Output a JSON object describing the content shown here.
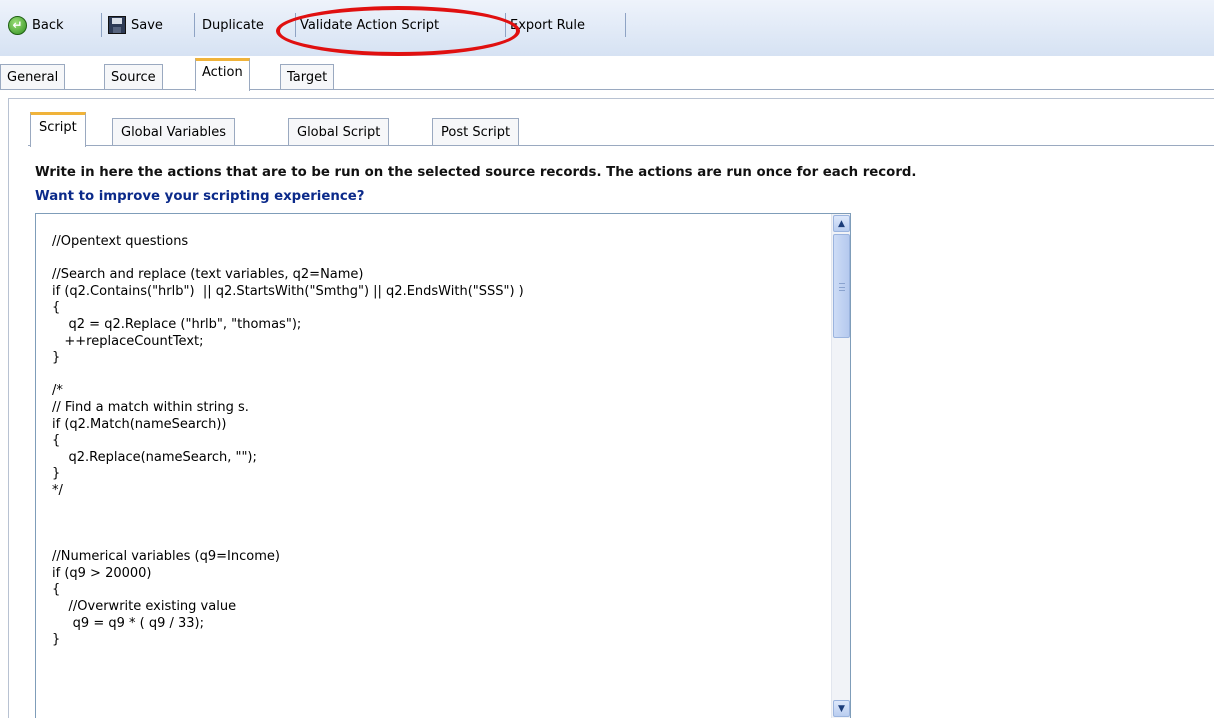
{
  "toolbar": {
    "back_label": "Back",
    "save_label": "Save",
    "duplicate_label": "Duplicate",
    "validate_label": "Validate Action Script",
    "export_label": "Export Rule",
    "back_icon_glyph": "↵"
  },
  "main_tabs": [
    {
      "label": "General",
      "active": false
    },
    {
      "label": "Source",
      "active": false
    },
    {
      "label": "Action",
      "active": true
    },
    {
      "label": "Target",
      "active": false
    }
  ],
  "sub_tabs": [
    {
      "label": "Script",
      "active": true
    },
    {
      "label": "Global Variables",
      "active": false
    },
    {
      "label": "Global Script",
      "active": false
    },
    {
      "label": "Post Script",
      "active": false
    }
  ],
  "description": "Write in here the actions that are to be run on the selected source records. The actions are run once for each record.",
  "improve_link": "Want to improve your scripting experience?",
  "script_lines": [
    "//Opentext questions",
    "",
    "//Search and replace (text variables, q2=Name)",
    "if (q2.Contains(\"hrlb\")  || q2.StartsWith(\"Smthg\") || q2.EndsWith(\"SSS\") )",
    "{",
    "    q2 = q2.Replace (\"hrlb\", \"thomas\");",
    "   ++replaceCountText;",
    "}",
    "",
    "/*",
    "// Find a match within string s.",
    "if (q2.Match(nameSearch))",
    "{",
    "    q2.Replace(nameSearch, \"\");",
    "}",
    "*/",
    "",
    "",
    "",
    "//Numerical variables (q9=Income)",
    "if (q9 > 20000)",
    "{",
    "    //Overwrite existing value",
    "     q9 = q9 * ( q9 / 33);",
    "}"
  ],
  "scrollbar": {
    "up_glyph": "▲",
    "down_glyph": "▼"
  },
  "colors": {
    "active_tab_accent": "#f0b33a",
    "highlight": "#e01010",
    "link": "#0b2a8a"
  }
}
